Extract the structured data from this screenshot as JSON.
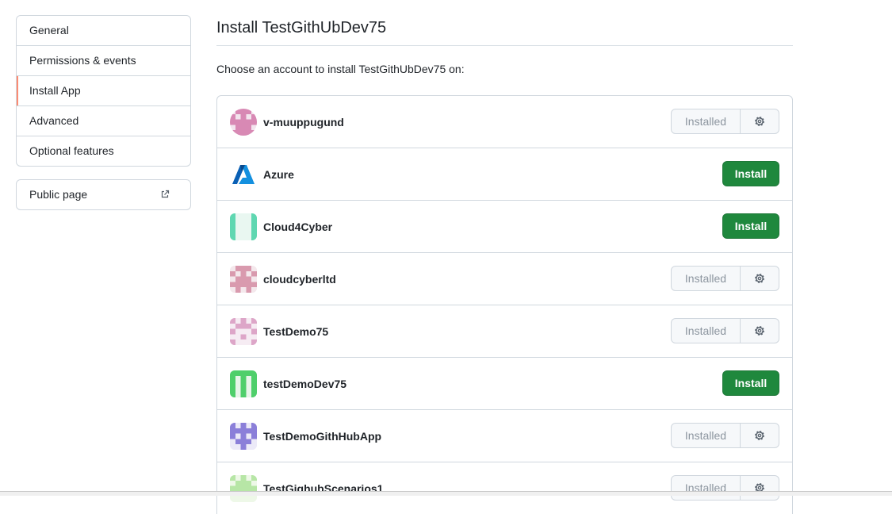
{
  "sidebar": {
    "items": [
      {
        "label": "General"
      },
      {
        "label": "Permissions & events"
      },
      {
        "label": "Install App"
      },
      {
        "label": "Advanced"
      },
      {
        "label": "Optional features"
      }
    ],
    "selected_index": 2,
    "public_page": {
      "label": "Public page",
      "icon": "external-link-icon"
    }
  },
  "main": {
    "title": "Install TestGithUbDev75",
    "subtitle": "Choose an account to install TestGithUbDev75 on:",
    "accounts": [
      {
        "name": "v-muuppugund",
        "status": "installed",
        "button_label": "Installed",
        "avatar": "identicon-pink"
      },
      {
        "name": "Azure",
        "status": "install",
        "button_label": "Install",
        "avatar": "azure-logo"
      },
      {
        "name": "Cloud4Cyber",
        "status": "install",
        "button_label": "Install",
        "avatar": "identicon-teal"
      },
      {
        "name": "cloudcyberltd",
        "status": "installed",
        "button_label": "Installed",
        "avatar": "identicon-rose"
      },
      {
        "name": "TestDemo75",
        "status": "installed",
        "button_label": "Installed",
        "avatar": "identicon-pink-light"
      },
      {
        "name": "testDemoDev75",
        "status": "install",
        "button_label": "Install",
        "avatar": "identicon-green"
      },
      {
        "name": "TestDemoGithHubApp",
        "status": "installed",
        "button_label": "Installed",
        "avatar": "identicon-purple"
      },
      {
        "name": "TestGighubScenarios1",
        "status": "installed",
        "button_label": "Installed",
        "avatar": "identicon-light-green"
      }
    ]
  },
  "colors": {
    "install_button": "#1f883d",
    "selected_accent": "#fd8c73",
    "border": "#d0d7de",
    "installed_text": "#8c959f"
  }
}
